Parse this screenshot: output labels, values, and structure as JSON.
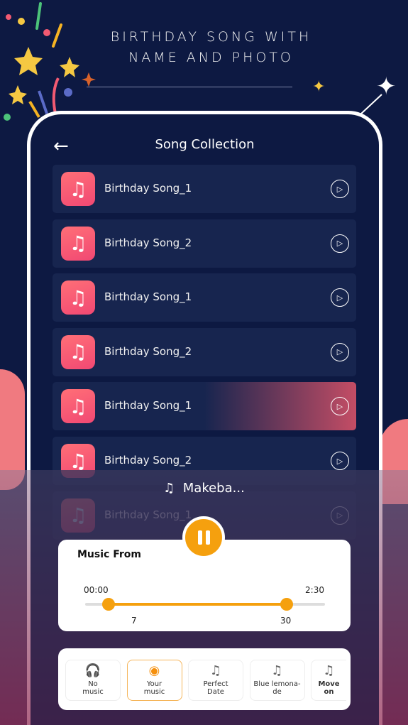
{
  "banner": {
    "line1": "BIRTHDAY SONG WITH",
    "line2": "NAME AND PHOTO"
  },
  "header": {
    "back_icon": "arrow-left-icon",
    "title": "Song Collection"
  },
  "songs": [
    {
      "name": "Birthday Song_1",
      "active": false
    },
    {
      "name": "Birthday Song_2",
      "active": false
    },
    {
      "name": "Birthday Song_1",
      "active": false
    },
    {
      "name": "Birthday Song_2",
      "active": false
    },
    {
      "name": "Birthday Song_1",
      "active": true
    },
    {
      "name": "Birthday Song_2",
      "active": false
    },
    {
      "name": "Birthday Song_1",
      "active": false
    }
  ],
  "now_playing": {
    "title": "Makeba..."
  },
  "music_from": {
    "label": "Music From",
    "start_time": "00:00",
    "end_time": "2:30",
    "range_start": "7",
    "range_end": "30",
    "range_start_value": 7,
    "range_end_value": 30,
    "total_seconds": 150
  },
  "music_options": [
    {
      "label1": "No",
      "label2": "music",
      "icon": "headphones-off-icon",
      "selected": false
    },
    {
      "label1": "Your",
      "label2": "music",
      "icon": "disc-icon",
      "selected": true
    },
    {
      "label1": "Perfect",
      "label2": "Date",
      "icon": "music-note-icon",
      "selected": false
    },
    {
      "label1": "Blue lemona-",
      "label2": "de",
      "icon": "music-note-icon",
      "selected": false
    },
    {
      "label1": "Move",
      "label2": "on",
      "icon": "music-note-icon",
      "selected": false
    }
  ],
  "colors": {
    "background": "#0d1942",
    "accent": "#f5a00e",
    "icon_pink": "#f14873"
  }
}
